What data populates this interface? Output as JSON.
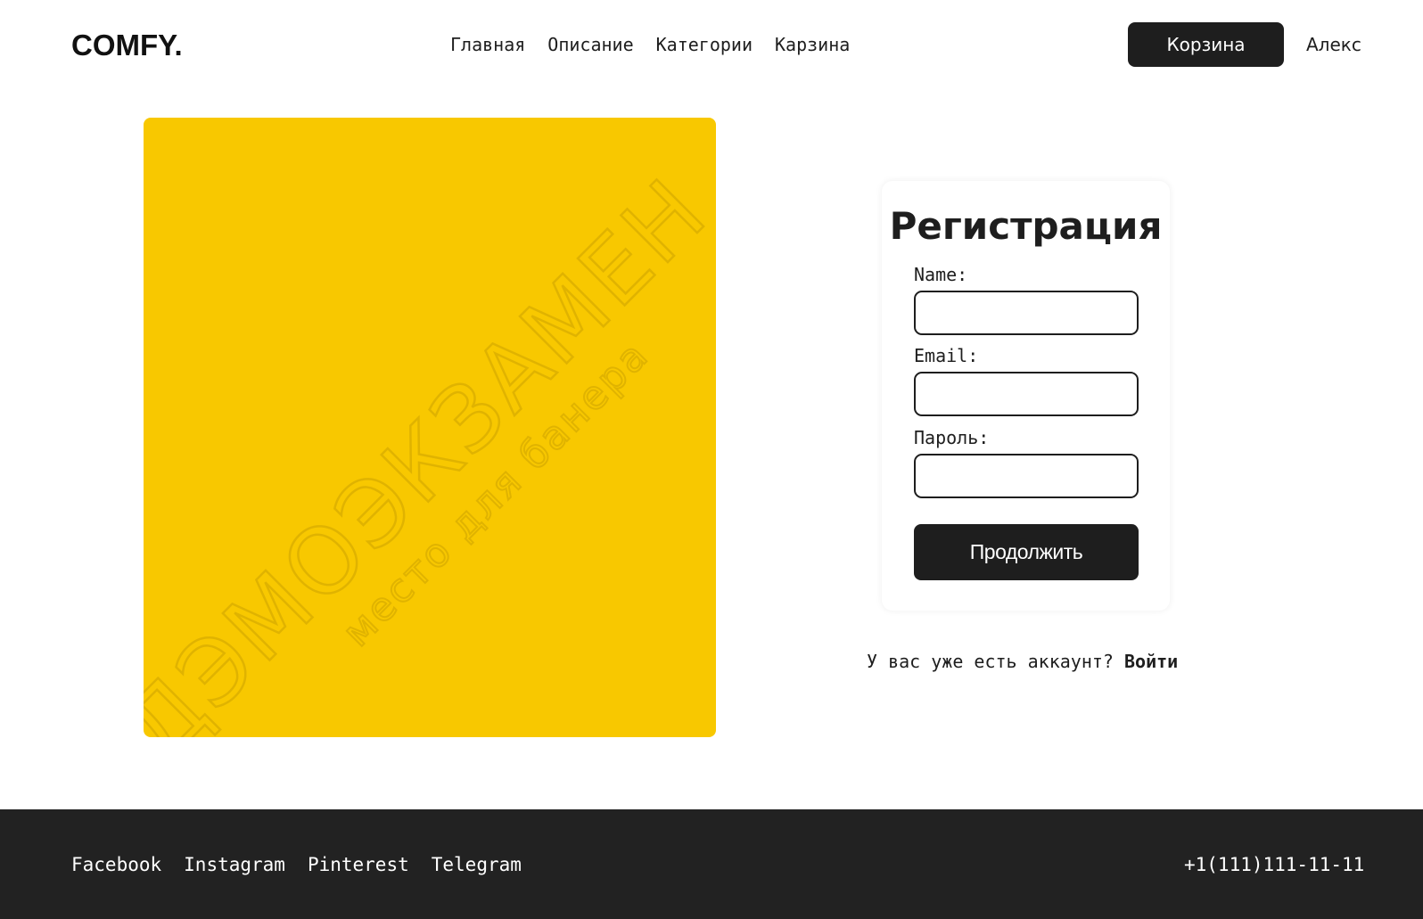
{
  "header": {
    "logo": "COMFY.",
    "nav": [
      "Главная",
      "Описание",
      "Категории",
      "Карзина"
    ],
    "cart_button": "Корзина",
    "user_name": "Алекс"
  },
  "banner": {
    "color": "#f8c800",
    "watermark_main": "ДЭМОЭКЗАМЕН",
    "watermark_sub": "место для банера"
  },
  "form": {
    "title": "Регистрация",
    "fields": [
      {
        "label": "Name:",
        "value": "",
        "placeholder": ""
      },
      {
        "label": "Email:",
        "value": "",
        "placeholder": ""
      },
      {
        "label": "Пароль:",
        "value": "",
        "placeholder": ""
      }
    ],
    "submit_label": "Продолжить"
  },
  "login_prompt": {
    "text": "У вас уже есть аккаунт? ",
    "link": "Войти"
  },
  "footer": {
    "links": [
      "Facebook",
      "Instagram",
      "Pinterest",
      "Telegram"
    ],
    "phone": "+1(111)111-11-11"
  },
  "colors": {
    "dark": "#1e1e1e",
    "footer_bg": "#222222",
    "accent_yellow": "#f8c800"
  }
}
